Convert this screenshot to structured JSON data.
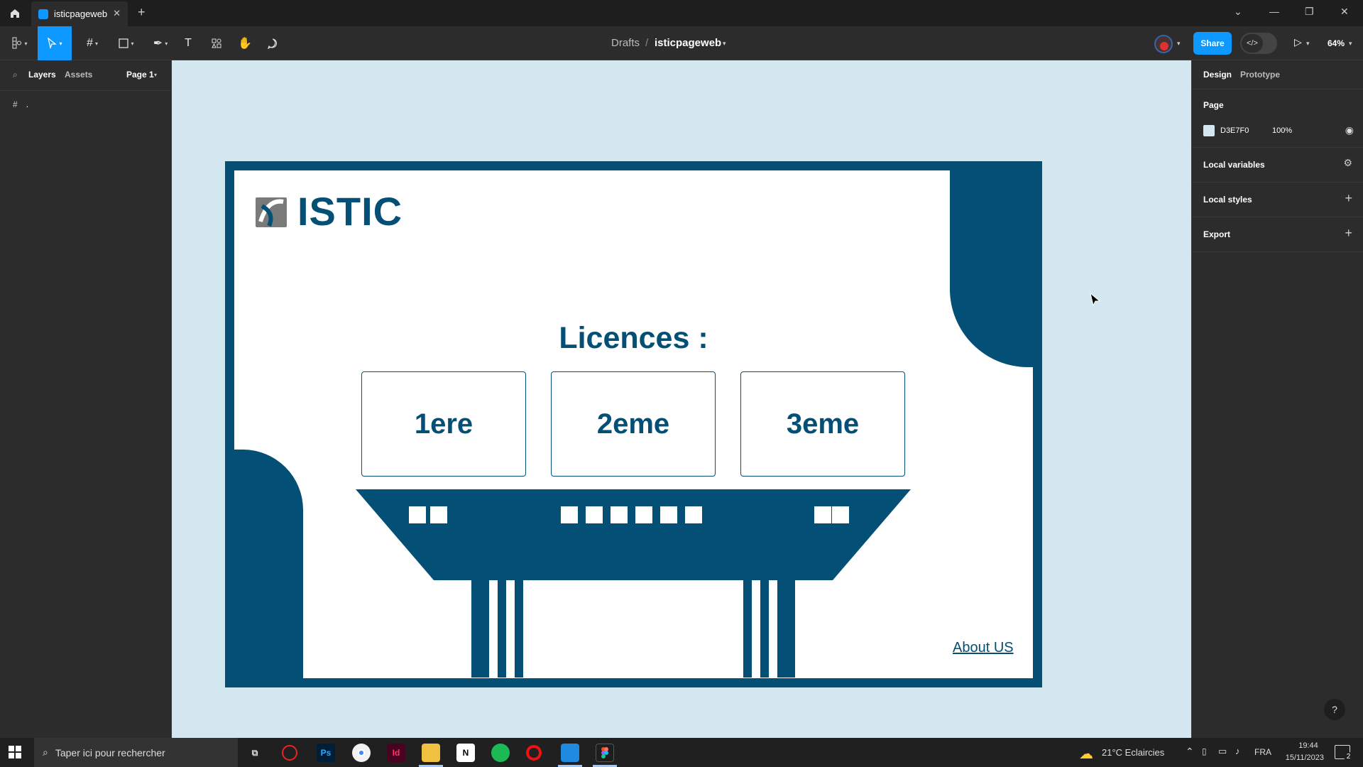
{
  "titlebar": {
    "tab_label": "isticpageweb",
    "close": "✕",
    "new_tab": "+"
  },
  "toolbar": {
    "breadcrumb_parent": "Drafts",
    "breadcrumb_sep": "/",
    "file_name": "isticpageweb",
    "share_label": "Share",
    "zoom": "64%"
  },
  "left_panel": {
    "tabs": [
      "Layers",
      "Assets"
    ],
    "page_select": "Page 1",
    "layers": [
      {
        "name": "."
      }
    ]
  },
  "right_panel": {
    "tabs": [
      "Design",
      "Prototype"
    ],
    "page_heading": "Page",
    "page_color_hex": "D3E7F0",
    "page_opacity": "100%",
    "sections": [
      "Local variables",
      "Local styles",
      "Export"
    ]
  },
  "design": {
    "logo_text": "ISTIC",
    "heading": "Licences :",
    "cards": [
      "1ere",
      "2eme",
      "3eme"
    ],
    "about_link": "About US",
    "colors": {
      "primary": "#044f75",
      "canvas": "#d3e7f0",
      "accent": "#0d99ff"
    }
  },
  "help": "?",
  "taskbar": {
    "search_placeholder": "Taper ici pour rechercher",
    "apps": [
      "Ps",
      "Id",
      "N"
    ],
    "weather": "21°C  Eclaircies",
    "language": "FRA",
    "time": "19:44",
    "date": "15/11/2023",
    "notifications": "2"
  }
}
